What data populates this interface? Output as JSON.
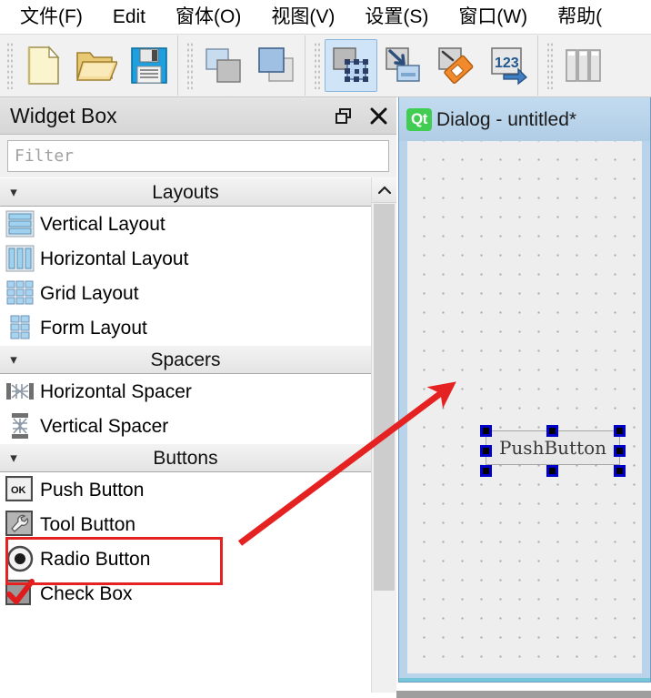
{
  "menubar": {
    "items": [
      {
        "text": "文件(F)",
        "accel": "F"
      },
      {
        "text": "Edit",
        "accel": "E"
      },
      {
        "text": "窗体(O)",
        "accel": "O"
      },
      {
        "text": "视图(V)",
        "accel": "V"
      },
      {
        "text": "设置(S)",
        "accel": "S"
      },
      {
        "text": "窗口(W)",
        "accel": "W"
      },
      {
        "text": "帮助(",
        "accel": ""
      }
    ]
  },
  "toolbar": {
    "buttons": [
      {
        "name": "new-file-icon",
        "tooltip": "New",
        "active": false
      },
      {
        "name": "open-file-icon",
        "tooltip": "Open",
        "active": false
      },
      {
        "name": "save-file-icon",
        "tooltip": "Save",
        "active": false
      },
      {
        "name": "send-to-back-icon",
        "tooltip": "Send to Back",
        "active": false
      },
      {
        "name": "bring-to-front-icon",
        "tooltip": "Bring to Front",
        "active": false
      },
      {
        "name": "edit-widgets-icon",
        "tooltip": "Edit Widgets",
        "active": true
      },
      {
        "name": "edit-signals-slots-icon",
        "tooltip": "Edit Signals/Slots",
        "active": false
      },
      {
        "name": "edit-buddies-icon",
        "tooltip": "Edit Buddies",
        "active": false
      },
      {
        "name": "edit-tab-order-icon",
        "tooltip": "Edit Tab Order",
        "active": false
      },
      {
        "name": "horizontal-layout-icon",
        "tooltip": "Lay Out Horizontally",
        "active": false
      }
    ]
  },
  "widget_box": {
    "title": "Widget Box",
    "restore_label": "Float",
    "close_label": "Close",
    "filter_placeholder": "Filter",
    "filter_value": "",
    "categories": [
      {
        "label": "Layouts",
        "expanded": true,
        "items": [
          {
            "label": "Vertical Layout",
            "icon": "vertical-layout-icon"
          },
          {
            "label": "Horizontal Layout",
            "icon": "horizontal-layout-icon"
          },
          {
            "label": "Grid Layout",
            "icon": "grid-layout-icon"
          },
          {
            "label": "Form Layout",
            "icon": "form-layout-icon"
          }
        ]
      },
      {
        "label": "Spacers",
        "expanded": true,
        "items": [
          {
            "label": "Horizontal Spacer",
            "icon": "horizontal-spacer-icon"
          },
          {
            "label": "Vertical Spacer",
            "icon": "vertical-spacer-icon"
          }
        ]
      },
      {
        "label": "Buttons",
        "expanded": true,
        "items": [
          {
            "label": "Push Button",
            "icon": "push-button-icon",
            "highlighted": true
          },
          {
            "label": "Tool Button",
            "icon": "tool-button-icon"
          },
          {
            "label": "Radio Button",
            "icon": "radio-button-icon"
          },
          {
            "label": "Check Box",
            "icon": "check-box-icon"
          }
        ]
      }
    ]
  },
  "dialog": {
    "title": "Dialog - untitled*",
    "logo_text": "Qt",
    "widgets": [
      {
        "type": "PushButton",
        "label": "PushButton",
        "selected": true,
        "handle_count": 8
      }
    ]
  },
  "annotations": {
    "highlight_color": "#e52222",
    "rect_target": "Push Button",
    "arrow_from": "Push Button",
    "arrow_to": "PushButton widget on canvas"
  },
  "colors": {
    "accent_blue": "#cfe4f7",
    "selection_handle": "#0000c8",
    "qt_green": "#41cd52",
    "annotation_red": "#e52222",
    "canvas_bg": "#eeeeee",
    "dialog_frame": "#b9d3ea"
  }
}
